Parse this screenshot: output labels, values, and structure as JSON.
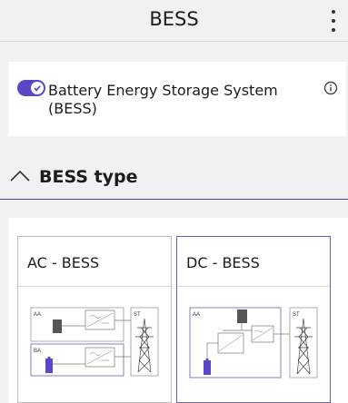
{
  "appbar": {
    "title": "BESS"
  },
  "toggle": {
    "label": "Battery Energy Storage System (BESS)",
    "checked": true
  },
  "section": {
    "title": "BESS type"
  },
  "options": [
    {
      "title": "AC - BESS",
      "selected": false,
      "labels": {
        "aa": "AA",
        "ba": "BA",
        "st": "ST"
      }
    },
    {
      "title": "DC - BESS",
      "selected": true,
      "labels": {
        "aa": "AA",
        "st": "ST"
      }
    }
  ],
  "colors": {
    "accent": "#5a47c8",
    "battery": "#5a47c8",
    "module": "#555555",
    "divider": "#4a3f8c"
  }
}
